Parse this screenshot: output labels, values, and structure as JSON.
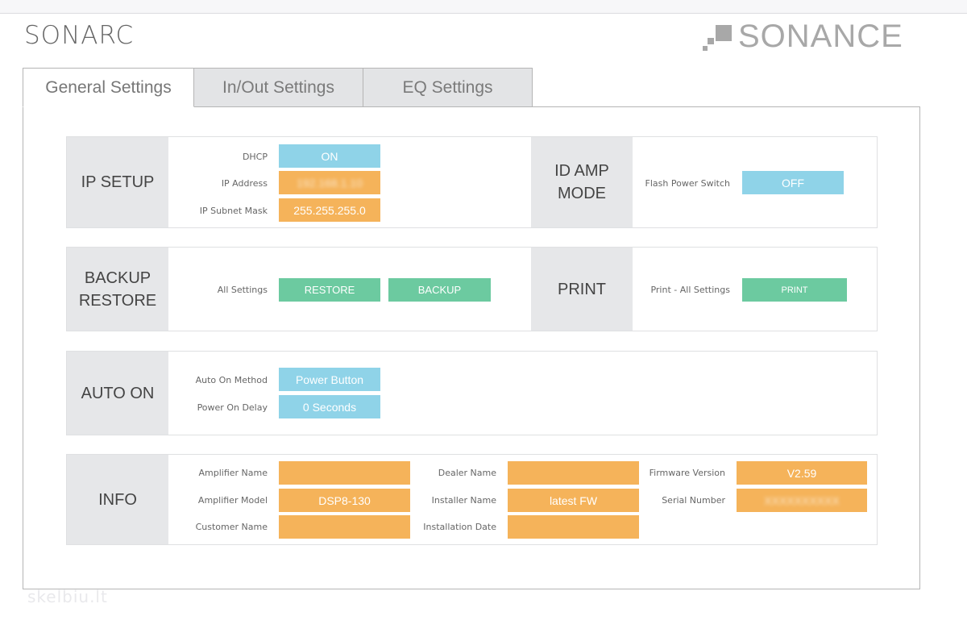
{
  "brand": {
    "left_logo": "SONARC",
    "right_logo": "SONANCE"
  },
  "tabs": [
    {
      "label": "General Settings",
      "active": true
    },
    {
      "label": "In/Out Settings",
      "active": false
    },
    {
      "label": "EQ Settings",
      "active": false
    }
  ],
  "ip_setup": {
    "title": "IP SETUP",
    "dhcp_label": "DHCP",
    "dhcp_value": "ON",
    "ip_label": "IP Address",
    "ip_value": "192.168.1.10",
    "mask_label": "IP Subnet Mask",
    "mask_value": "255.255.255.0"
  },
  "id_amp": {
    "title_line1": "ID AMP",
    "title_line2": "MODE",
    "flash_label": "Flash Power Switch",
    "flash_value": "OFF"
  },
  "backup": {
    "title_line1": "BACKUP",
    "title_line2": "RESTORE",
    "all_label": "All Settings",
    "restore_label": "RESTORE",
    "backup_label": "BACKUP"
  },
  "print": {
    "title": "PRINT",
    "label": "Print - All Settings",
    "button": "PRINT"
  },
  "auto_on": {
    "title": "AUTO ON",
    "method_label": "Auto On Method",
    "method_value": "Power Button",
    "delay_label": "Power On Delay",
    "delay_value": "0 Seconds"
  },
  "info": {
    "title": "INFO",
    "amp_name_label": "Amplifier Name",
    "amp_name_value": "",
    "amp_model_label": "Amplifier Model",
    "amp_model_value": "DSP8-130",
    "customer_label": "Customer Name",
    "customer_value": "",
    "dealer_label": "Dealer Name",
    "dealer_value": "",
    "installer_label": "Installer Name",
    "installer_value": "latest FW",
    "install_date_label": "Installation Date",
    "install_date_value": "",
    "firmware_label": "Firmware Version",
    "firmware_value": "V2.59",
    "serial_label": "Serial Number",
    "serial_value": "XXXXXXXXXX"
  },
  "watermark": "skelbiu.lt",
  "colors": {
    "blue": "#8fd3e8",
    "orange": "#f5b35a",
    "green": "#6ccaa0",
    "label_bg": "#e6e7e9"
  }
}
